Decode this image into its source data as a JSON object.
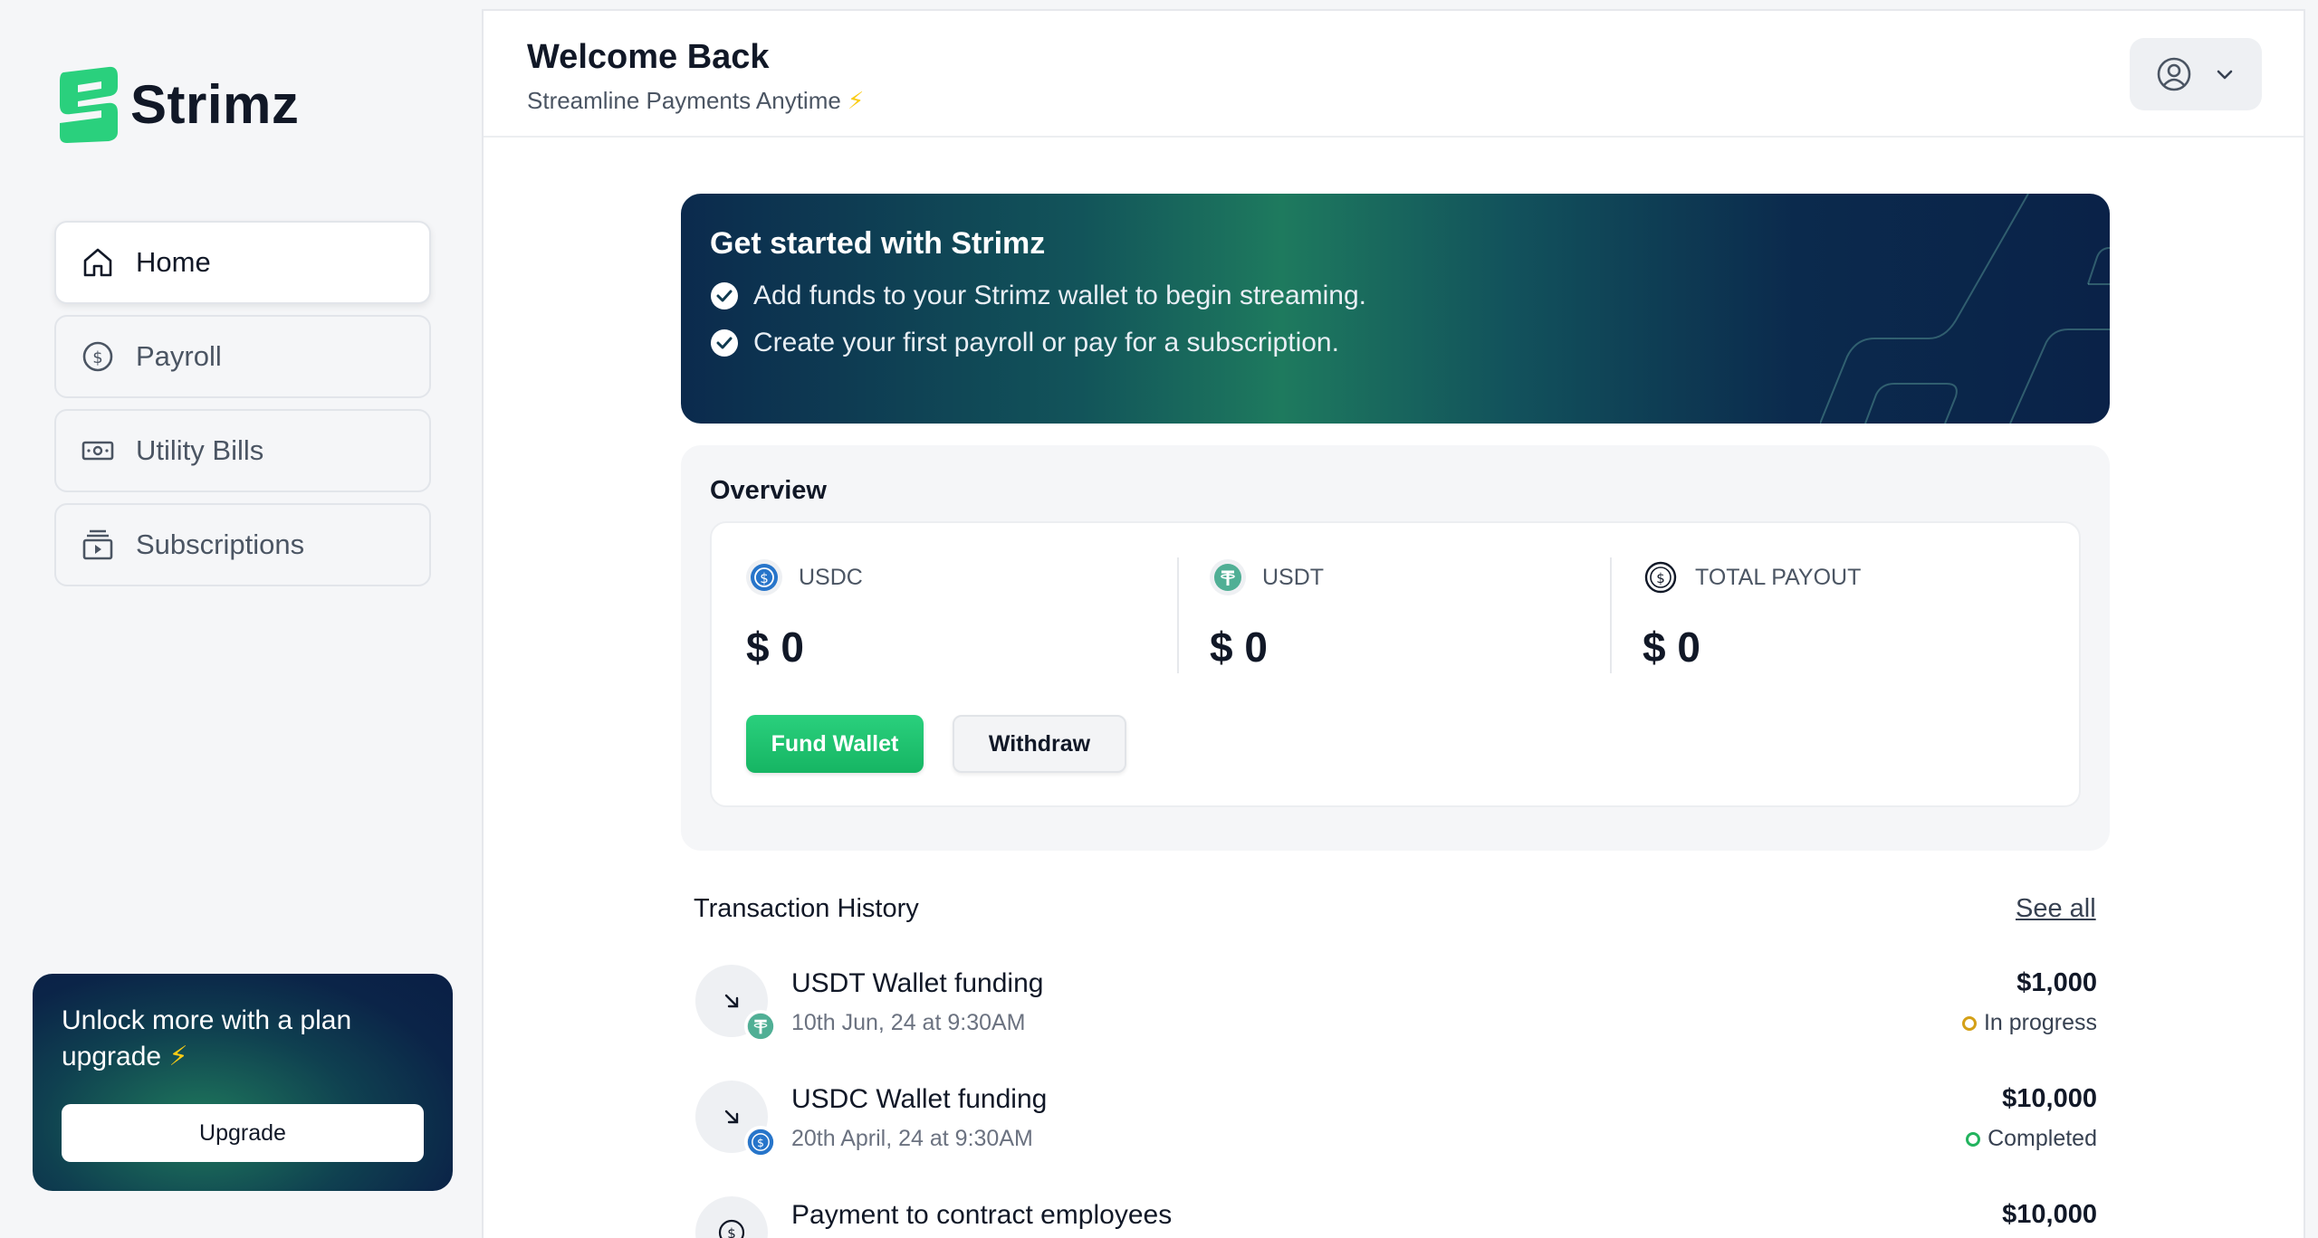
{
  "brand": {
    "name": "Strimz",
    "logo_color": "#2ad07d"
  },
  "sidebar": {
    "items": [
      {
        "label": "Home",
        "icon": "home-icon",
        "active": true
      },
      {
        "label": "Payroll",
        "icon": "dollar-circle-icon",
        "active": false
      },
      {
        "label": "Utility Bills",
        "icon": "banknote-icon",
        "active": false
      },
      {
        "label": "Subscriptions",
        "icon": "subscriptions-icon",
        "active": false
      }
    ],
    "upgrade": {
      "title": "Unlock more with a plan upgrade",
      "bolt": "⚡",
      "button": "Upgrade"
    }
  },
  "header": {
    "title": "Welcome Back",
    "subtitle": "Streamline Payments Anytime",
    "bolt": "⚡"
  },
  "banner": {
    "title": "Get started with Strimz",
    "items": [
      "Add funds to your Strimz wallet to begin streaming.",
      "Create your first payroll or pay for a subscription."
    ]
  },
  "overview": {
    "title": "Overview",
    "stats": [
      {
        "label": "USDC",
        "value": "$ 0",
        "icon": "usdc-icon"
      },
      {
        "label": "USDT",
        "value": "$ 0",
        "icon": "usdt-icon"
      },
      {
        "label": "TOTAL PAYOUT",
        "value": "$ 0",
        "icon": "dollar-circle-icon"
      }
    ],
    "fund_button": "Fund Wallet",
    "withdraw_button": "Withdraw"
  },
  "transactions": {
    "title": "Transaction History",
    "see_all": "See all",
    "rows": [
      {
        "name": "USDT Wallet funding",
        "date": "10th Jun, 24 at 9:30AM",
        "amount": "$1,000",
        "status": "In progress",
        "status_color": "#d4a017",
        "token": "usdt-icon"
      },
      {
        "name": "USDC Wallet funding",
        "date": "20th April, 24 at 9:30AM",
        "amount": "$10,000",
        "status": "Completed",
        "status_color": "#22b35e",
        "token": "usdc-icon"
      },
      {
        "name": "Payment to contract employees",
        "date": "",
        "amount": "$10,000",
        "status": "",
        "status_color": "",
        "token": "dollar-circle-icon"
      }
    ]
  },
  "colors": {
    "accent_green": "#22c16e",
    "banner_dark": "#0b2a4d",
    "usdt": "#50af95",
    "usdc": "#2775ca"
  }
}
